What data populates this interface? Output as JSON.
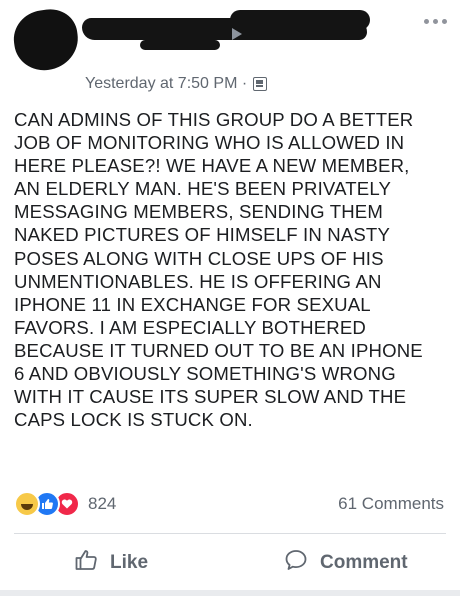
{
  "post": {
    "timestamp": "Yesterday at 7:50 PM ·",
    "text_lines": [
      "CAN ADMINS OF THIS GROUP DO A BETTER",
      "JOB OF MONITORING WHO IS ALLOWED IN",
      "HERE PLEASE?! WE HAVE A NEW MEMBER,",
      "AN ELDERLY MAN. HE'S BEEN PRIVATELY",
      "MESSAGING MEMBERS, SENDING THEM",
      "NAKED PICTURES OF HIMSELF IN NASTY",
      "POSES ALONG WITH CLOSE UPS OF HIS",
      "UNMENTIONABLES. HE IS OFFERING AN",
      "IPHONE 11 IN EXCHANGE FOR SEXUAL",
      "FAVORS. I AM ESPECIALLY BOTHERED",
      "BECAUSE IT TURNED OUT TO BE AN IPHONE",
      "6 AND OBVIOUSLY SOMETHING'S WRONG",
      "WITH IT CAUSE ITS SUPER SLOW AND THE",
      "CAPS LOCK IS STUCK ON."
    ]
  },
  "reactions": {
    "count": "824",
    "icons": [
      "haha-icon",
      "like-icon",
      "love-icon"
    ]
  },
  "comments": {
    "count_label": "61 Comments"
  },
  "actions": {
    "like_label": "Like",
    "comment_label": "Comment"
  },
  "icons": {
    "audience": "group-audience-icon",
    "more": "more-options-icon"
  },
  "colors": {
    "like_blue": "#2078f4",
    "love_red": "#f0284a",
    "haha_yellow": "#f7c948",
    "meta_gray": "#606770"
  }
}
